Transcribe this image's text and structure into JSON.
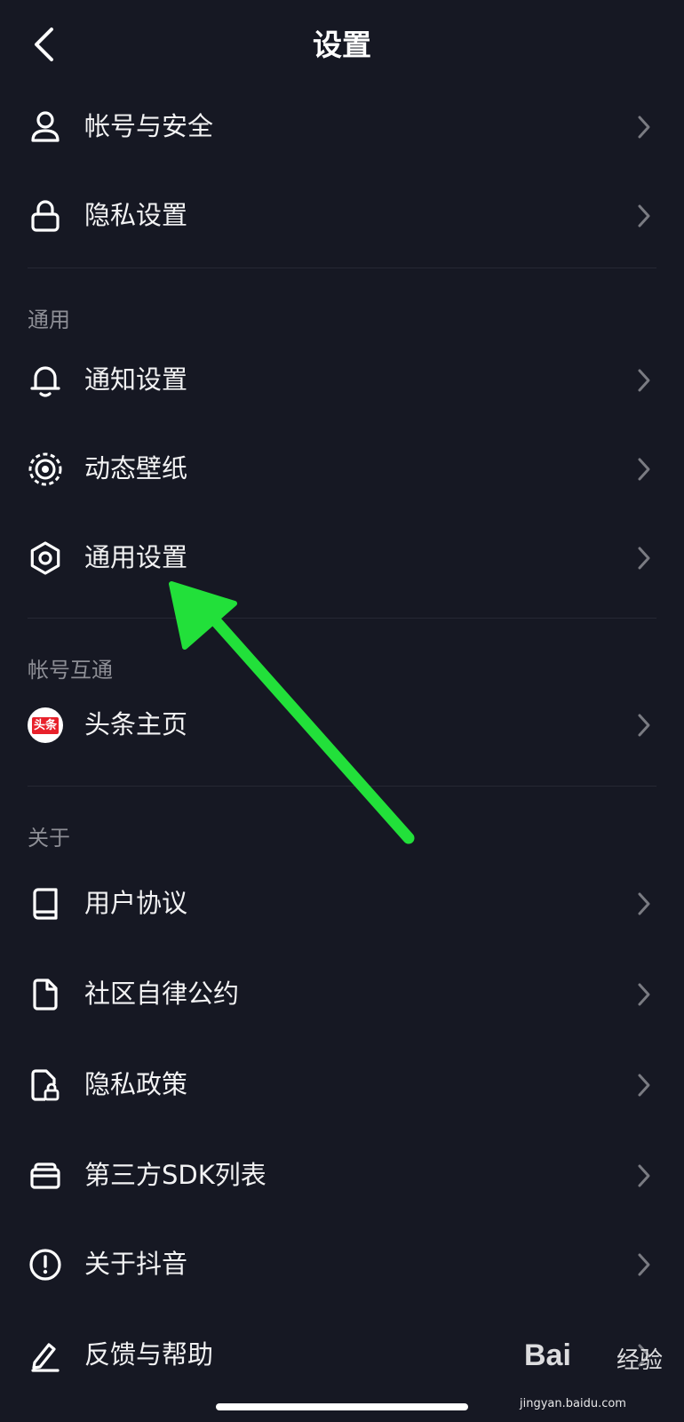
{
  "header": {
    "title": "设置"
  },
  "rows": [
    {
      "label": "帐号与安全",
      "icon": "person-icon"
    },
    {
      "label": "隐私设置",
      "icon": "lock-icon"
    },
    {
      "label": "通知设置",
      "icon": "bell-icon"
    },
    {
      "label": "动态壁纸",
      "icon": "wallpaper-icon"
    },
    {
      "label": "通用设置",
      "icon": "gear-icon"
    },
    {
      "label": "头条主页",
      "icon": "toutiao-logo"
    },
    {
      "label": "用户协议",
      "icon": "book-icon"
    },
    {
      "label": "社区自律公约",
      "icon": "document-icon"
    },
    {
      "label": "隐私政策",
      "icon": "document-lock-icon"
    },
    {
      "label": "第三方SDK列表",
      "icon": "wallet-icon"
    },
    {
      "label": "关于抖音",
      "icon": "info-icon"
    },
    {
      "label": "反馈与帮助",
      "icon": "pencil-icon"
    }
  ],
  "sections": {
    "general": "通用",
    "account_link": "帐号互通",
    "about": "关于"
  },
  "toutiao_logo_text": "头条",
  "watermark": {
    "brand": "Bai",
    "brand_cn": "经验",
    "url": "jingyan.baidu.com"
  },
  "colors": {
    "background": "#161823",
    "arrow": "#22e03a",
    "section_text": "#8d8e95"
  }
}
